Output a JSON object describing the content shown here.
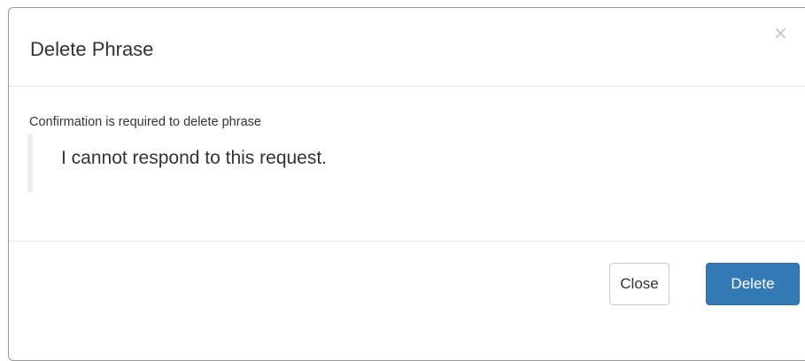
{
  "dialog": {
    "title": "Delete Phrase",
    "close_icon": "×",
    "message": "Confirmation is required to delete phrase",
    "phrase": "I cannot respond to this request.",
    "buttons": {
      "close_label": "Close",
      "delete_label": "Delete"
    }
  },
  "colors": {
    "primary": "#337ab7",
    "border": "#e5e5e5",
    "quote_border": "#eeeeee"
  }
}
